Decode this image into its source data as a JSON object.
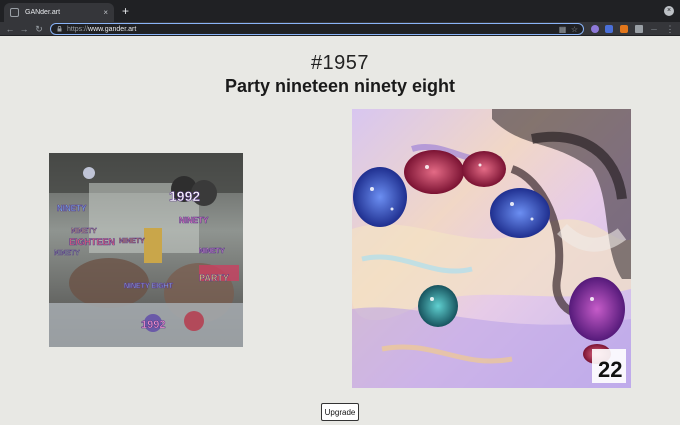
{
  "browser": {
    "tab_title": "GANder.art",
    "tab_close": "×",
    "new_tab": "+",
    "url_prefix": "https://",
    "url_host": "www.gander.art",
    "window_close": "×"
  },
  "artwork": {
    "number": "#1957",
    "title": "Party nineteen ninety eight"
  },
  "source_image": {
    "text_labels": [
      "1992",
      "NINETY",
      "NINETY",
      "NINETY",
      "NINETY",
      "NINETY",
      "NINETY",
      "NINETY EIGHT",
      "PARTY",
      "EIGHTEEN",
      "1992"
    ]
  },
  "generated_image": {
    "corner_label": "22"
  },
  "actions": {
    "upgrade_label": "Upgrade"
  },
  "colors": {
    "page_bg": "#e8e8e4",
    "chrome_dark": "#202124",
    "chrome_tab": "#35363a",
    "omnibox_border": "#8ab4f8"
  }
}
